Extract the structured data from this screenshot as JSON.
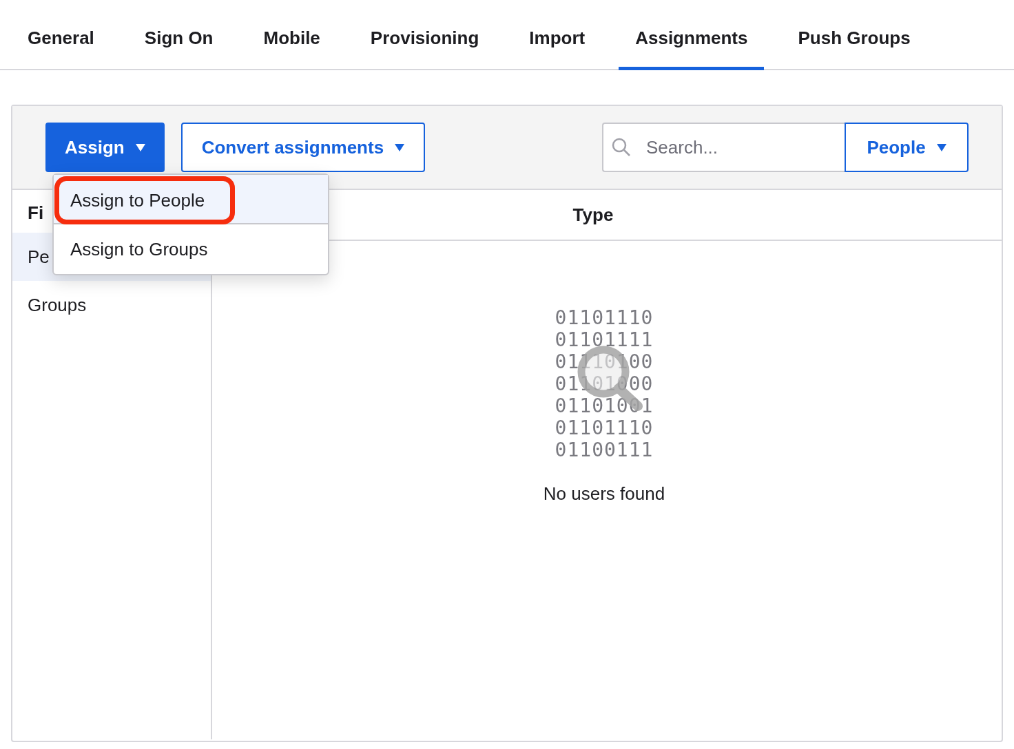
{
  "tabs": [
    {
      "label": "General",
      "selected": false
    },
    {
      "label": "Sign On",
      "selected": false
    },
    {
      "label": "Mobile",
      "selected": false
    },
    {
      "label": "Provisioning",
      "selected": false
    },
    {
      "label": "Import",
      "selected": false
    },
    {
      "label": "Assignments",
      "selected": true
    },
    {
      "label": "Push Groups",
      "selected": false
    }
  ],
  "toolbar": {
    "assign_button": "Assign",
    "convert_button": "Convert assignments",
    "search": {
      "placeholder": "Search..."
    },
    "filter_button": "People"
  },
  "assign_menu": {
    "items": [
      {
        "label": "Assign to People",
        "selected": true,
        "highlighted": true
      },
      {
        "label": "Assign to Groups",
        "selected": false,
        "highlighted": false
      }
    ]
  },
  "sidebar": {
    "heading": "Fi",
    "items": [
      {
        "label": "Pe",
        "selected": true
      },
      {
        "label": "Groups",
        "selected": false
      }
    ]
  },
  "table": {
    "columns": [
      "Type"
    ]
  },
  "empty_state": {
    "illustration_lines": [
      "01101110",
      "01101111",
      "01110100",
      "01101000",
      "01101001",
      "01101110",
      "01100111"
    ],
    "message": "No users found"
  }
}
